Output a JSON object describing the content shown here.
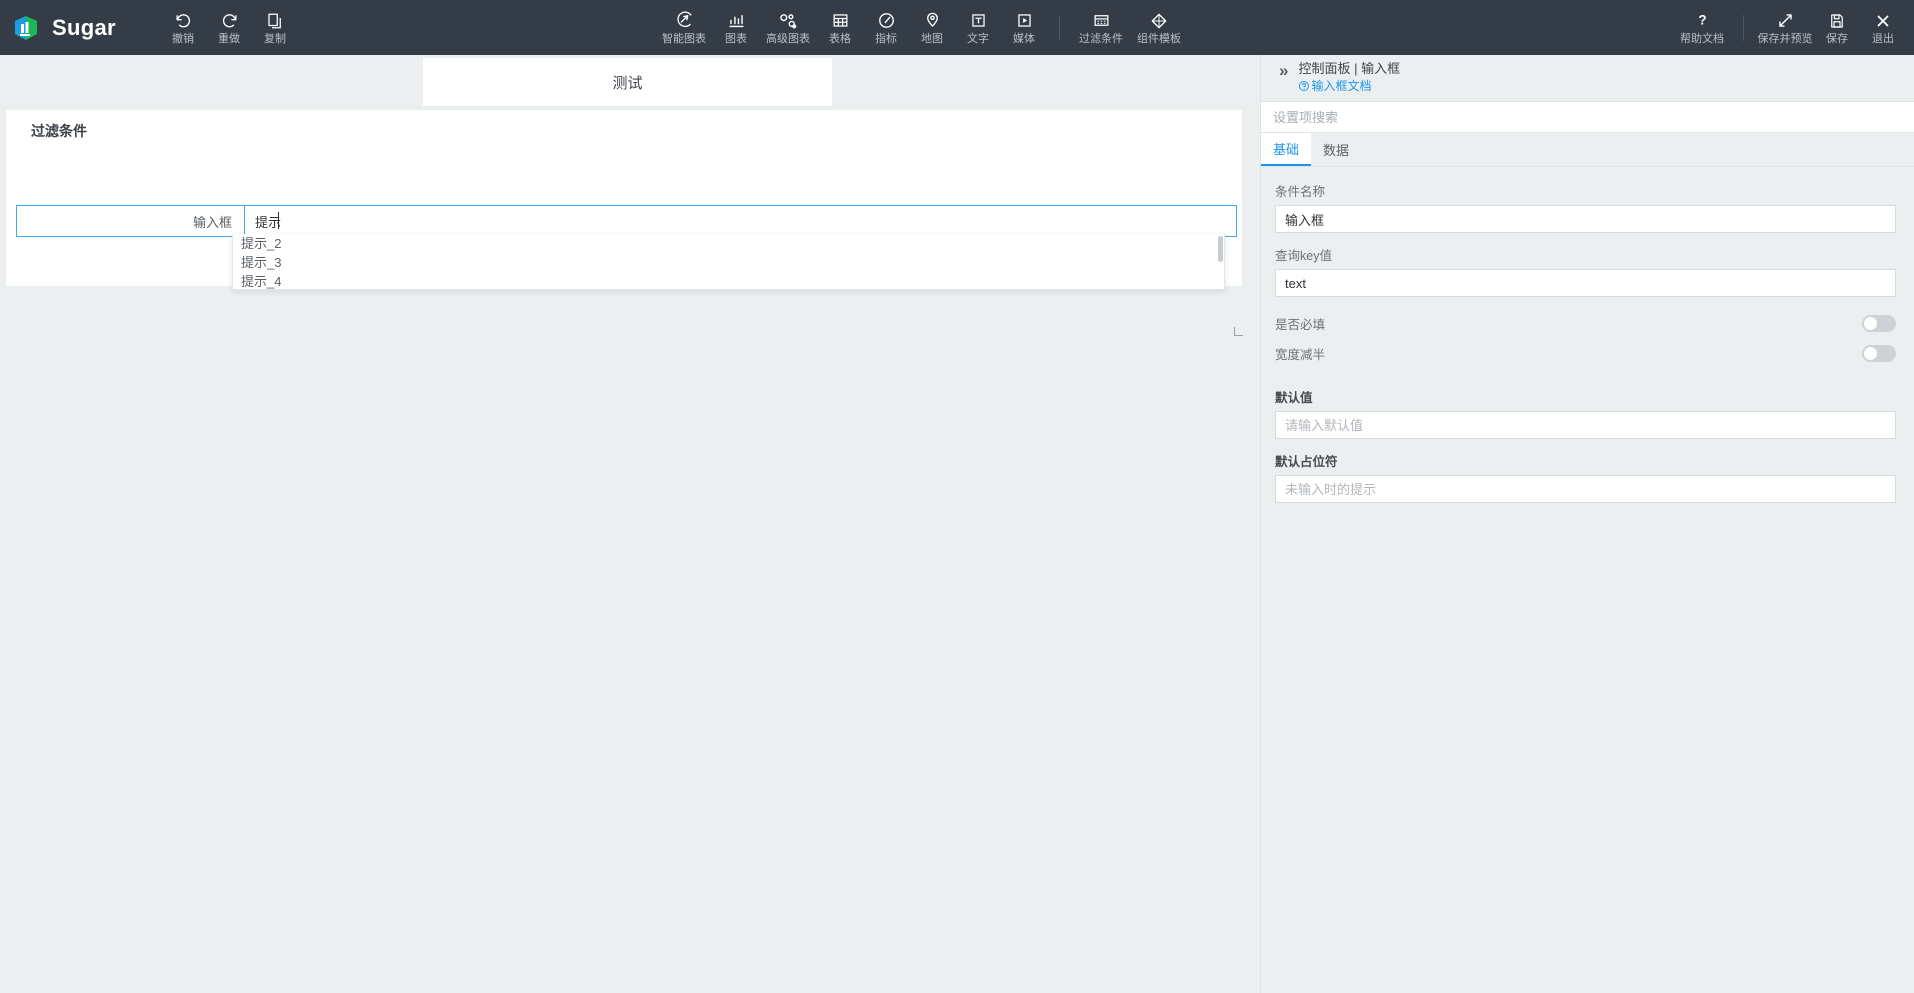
{
  "app": {
    "brand": "Sugar",
    "logo_icon": "sugar-cube-logo"
  },
  "toolbar": {
    "left": [
      {
        "label": "撤销",
        "icon": "undo-icon"
      },
      {
        "label": "重做",
        "icon": "redo-icon"
      },
      {
        "label": "复制",
        "icon": "copy-icon"
      }
    ],
    "center": [
      {
        "label": "智能图表",
        "icon": "smart-chart-icon"
      },
      {
        "label": "图表",
        "icon": "bar-chart-icon"
      },
      {
        "label": "高级图表",
        "icon": "advanced-chart-icon"
      },
      {
        "label": "表格",
        "icon": "table-icon"
      },
      {
        "label": "指标",
        "icon": "gauge-icon"
      },
      {
        "label": "地图",
        "icon": "map-pin-icon"
      },
      {
        "label": "文字",
        "icon": "text-icon"
      },
      {
        "label": "媒体",
        "icon": "media-play-icon"
      }
    ],
    "center_group2": [
      {
        "label": "过滤条件",
        "icon": "filter-panel-icon"
      },
      {
        "label": "组件模板",
        "icon": "component-template-icon"
      }
    ],
    "right_help": [
      {
        "label": "帮助文档",
        "icon": "question-mark-icon"
      }
    ],
    "right_actions": [
      {
        "label": "保存并预览",
        "icon": "expand-arrows-icon"
      },
      {
        "label": "保存",
        "icon": "save-disk-icon"
      },
      {
        "label": "退出",
        "icon": "close-x-icon"
      }
    ]
  },
  "canvas": {
    "title_card": {
      "text": "测试"
    },
    "filter_card": {
      "heading": "过滤条件",
      "field_label": "输入框",
      "input_value": "提示",
      "input_placeholder": "",
      "dropdown_options": [
        "提示_2",
        "提示_3",
        "提示_4"
      ]
    }
  },
  "panel": {
    "collapse_icon": "chevron-double-right-icon",
    "title": "控制面板 | 输入框",
    "doc_link": "输入框文档",
    "doc_icon": "help-circle-icon",
    "search_placeholder": "设置项搜索",
    "tabs": [
      {
        "label": "基础",
        "active": true
      },
      {
        "label": "数据",
        "active": false
      }
    ],
    "fields": {
      "name_label": "条件名称",
      "name_value": "输入框",
      "key_label": "查询key值",
      "key_value": "text",
      "required_label": "是否必填",
      "required_on": false,
      "half_width_label": "宽度减半",
      "half_width_on": false,
      "default_value_label": "默认值",
      "default_value_placeholder": "请输入默认值",
      "default_value": "",
      "placeholder_label": "默认占位符",
      "placeholder_placeholder": "未输入时的提示",
      "placeholder_value": ""
    }
  },
  "colors": {
    "topbar_bg": "#343d47",
    "accent": "#1d95f0",
    "canvas_bg": "#eceff0",
    "focus_border": "#3fa9f5"
  }
}
